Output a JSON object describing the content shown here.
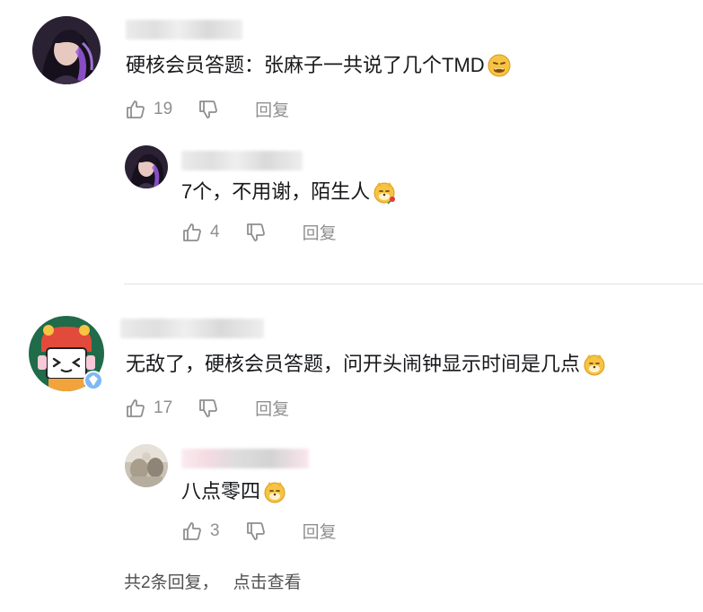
{
  "comments": [
    {
      "text": "硬核会员答题：张麻子一共说了几个TMD",
      "emoji": "vomiting-face-emoji",
      "likes": "19",
      "reply_label": "回复",
      "replies": [
        {
          "text": "7个，不用谢，陌生人",
          "emoji": "doge-rose-emoji",
          "likes": "4",
          "reply_label": "回复"
        }
      ]
    },
    {
      "text": "无敌了，硬核会员答题，问开头闹钟显示时间是几点",
      "emoji": "doge-emoji",
      "likes": "17",
      "reply_label": "回复",
      "replies": [
        {
          "text": "八点零四",
          "emoji": "doge-emoji",
          "likes": "3",
          "reply_label": "回复"
        }
      ]
    }
  ],
  "more_replies": {
    "count_text": "共2条回复，",
    "link_text": "点击查看"
  },
  "colors": {
    "text": "#18191c",
    "meta": "#8f8f8f",
    "divider": "#e3e3e3",
    "emoji_yellow": "#f6c343"
  }
}
